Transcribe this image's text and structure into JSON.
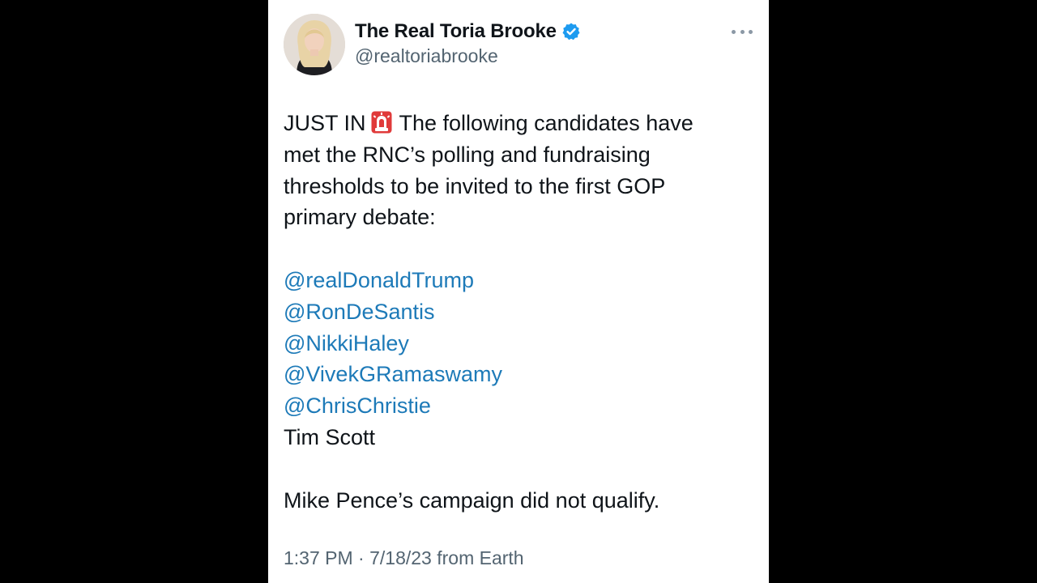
{
  "author": {
    "display_name": "The Real Toria Brooke",
    "handle": "@realtoriabrooke",
    "avatar_icon": "profile-photo",
    "verified_icon": "verified-badge-icon",
    "verified_color": "#1d9bf0"
  },
  "tweet": {
    "intro_start": "JUST IN",
    "siren_icon": "rotating-light-emoji",
    "intro_line1_rest": "The following candidates have",
    "intro_line2": "met the RNC’s polling and fundraising",
    "intro_line3": "thresholds to be invited to the first GOP",
    "intro_line4": "primary debate:",
    "mentions": [
      "@realDonaldTrump",
      "@RonDeSantis",
      "@NikkiHaley",
      "@VivekGRamaswamy",
      "@ChrisChristie"
    ],
    "plain_name": "Tim Scott",
    "closing": "Mike Pence’s campaign did not qualify."
  },
  "meta": {
    "timestamp_line": "1:37 PM · 7/18/23 from Earth"
  },
  "colors": {
    "background": "#000000",
    "card": "#ffffff",
    "text": "#0f1419",
    "secondary_text": "#536471",
    "mention": "#1d7ab8"
  }
}
